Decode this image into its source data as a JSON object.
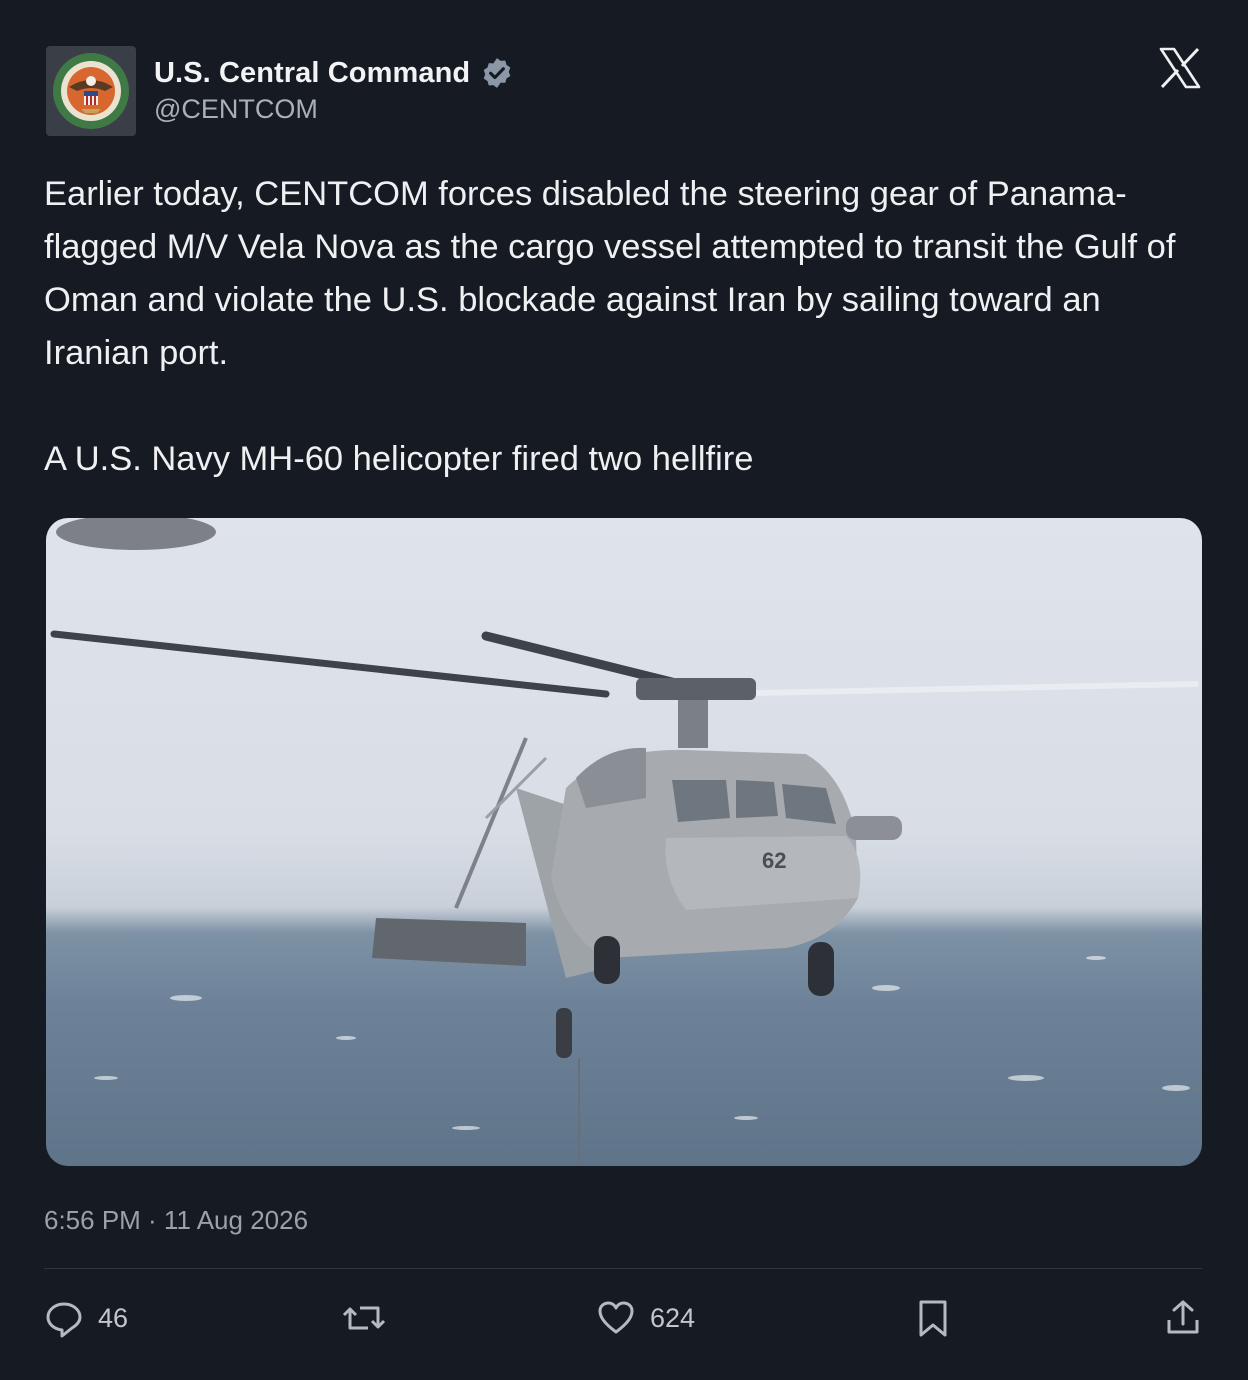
{
  "author": {
    "display_name": "U.S. Central Command",
    "handle": "@CENTCOM",
    "verified": true,
    "avatar_icon": "centcom-seal-icon",
    "avatar_text_top": "UNITED STATES",
    "avatar_text_bottom": "CENTRAL COMMAND"
  },
  "platform_logo": "x-logo-icon",
  "tweet": {
    "text": "Earlier today, CENTCOM forces disabled the steering gear of Panama-flagged M/V Vela Nova as the cargo vessel attempted to transit the Gulf of Oman and violate the U.S. blockade against Iran by sailing toward an Iranian port.\n\nA U.S. Navy MH-60 helicopter fired two hellfire",
    "media_icon": "helicopter-over-sea-photo",
    "aircraft_marking": "62",
    "timestamp": "6:56 PM · 11 Aug 2026"
  },
  "actions": {
    "replies": "46",
    "reposts": "",
    "likes": "624",
    "reply_icon": "reply-icon",
    "repost_icon": "repost-icon",
    "like_icon": "heart-icon",
    "bookmark_icon": "bookmark-icon",
    "share_icon": "share-icon"
  },
  "colors": {
    "background": "#161a23",
    "text": "#eef0f1",
    "secondary": "#9aa1a8",
    "verified_badge": "#8b97a6"
  }
}
